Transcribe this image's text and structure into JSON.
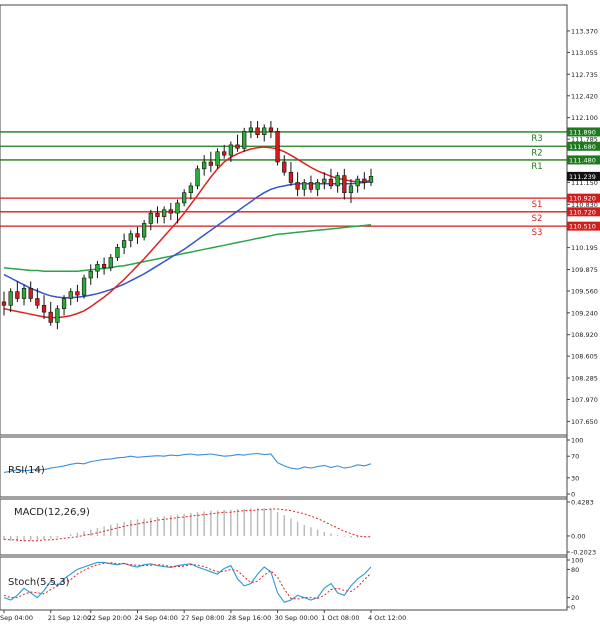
{
  "chart_data": {
    "type": "candlestick",
    "main": {
      "ylim": [
        107.45,
        113.75
      ],
      "yticks": [
        "113.370",
        "113.055",
        "112.735",
        "112.420",
        "112.100",
        "111.785",
        "111.465",
        "111.150",
        "110.830",
        "110.515",
        "110.195",
        "109.875",
        "109.560",
        "109.240",
        "108.920",
        "108.605",
        "108.285",
        "107.970",
        "107.650"
      ],
      "ytick_values": [
        113.37,
        113.055,
        112.735,
        112.42,
        112.1,
        111.785,
        111.465,
        111.15,
        110.83,
        110.515,
        110.195,
        109.875,
        109.56,
        109.24,
        108.92,
        108.605,
        108.285,
        107.97,
        107.65
      ],
      "current_price": {
        "label": "111.239",
        "value": 111.239
      },
      "levels": [
        {
          "name": "R3",
          "value": 111.89,
          "label": "111.890",
          "kind": "resistance"
        },
        {
          "name": "R2",
          "value": 111.68,
          "label": "111.680",
          "kind": "resistance"
        },
        {
          "name": "R1",
          "value": 111.48,
          "label": "111.480",
          "kind": "resistance"
        },
        {
          "name": "S1",
          "value": 110.92,
          "label": "110.920",
          "kind": "support"
        },
        {
          "name": "S2",
          "value": 110.72,
          "label": "110.720",
          "kind": "support"
        },
        {
          "name": "S3",
          "value": 110.51,
          "label": "110.510",
          "kind": "support"
        }
      ],
      "candles": [
        [
          109.4,
          109.55,
          109.2,
          109.35
        ],
        [
          109.35,
          109.6,
          109.25,
          109.55
        ],
        [
          109.55,
          109.7,
          109.4,
          109.45
        ],
        [
          109.45,
          109.65,
          109.35,
          109.6
        ],
        [
          109.6,
          109.7,
          109.4,
          109.45
        ],
        [
          109.45,
          109.6,
          109.3,
          109.35
        ],
        [
          109.35,
          109.5,
          109.15,
          109.25
        ],
        [
          109.25,
          109.4,
          109.05,
          109.1
        ],
        [
          109.1,
          109.35,
          109.0,
          109.3
        ],
        [
          109.3,
          109.5,
          109.2,
          109.45
        ],
        [
          109.45,
          109.6,
          109.35,
          109.55
        ],
        [
          109.55,
          109.65,
          109.4,
          109.5
        ],
        [
          109.5,
          109.8,
          109.45,
          109.75
        ],
        [
          109.75,
          109.95,
          109.65,
          109.85
        ],
        [
          109.85,
          110.0,
          109.75,
          109.95
        ],
        [
          109.95,
          110.05,
          109.8,
          109.9
        ],
        [
          109.9,
          110.1,
          109.85,
          110.05
        ],
        [
          110.05,
          110.25,
          110.0,
          110.2
        ],
        [
          110.2,
          110.4,
          110.1,
          110.3
        ],
        [
          110.3,
          110.45,
          110.2,
          110.4
        ],
        [
          110.4,
          110.5,
          110.25,
          110.35
        ],
        [
          110.35,
          110.6,
          110.3,
          110.55
        ],
        [
          110.55,
          110.75,
          110.45,
          110.7
        ],
        [
          110.7,
          110.8,
          110.55,
          110.65
        ],
        [
          110.65,
          110.8,
          110.55,
          110.75
        ],
        [
          110.75,
          110.85,
          110.6,
          110.7
        ],
        [
          110.7,
          110.9,
          110.55,
          110.85
        ],
        [
          110.85,
          111.05,
          110.8,
          111.0
        ],
        [
          111.0,
          111.15,
          110.9,
          111.1
        ],
        [
          111.1,
          111.4,
          111.05,
          111.35
        ],
        [
          111.35,
          111.55,
          111.25,
          111.45
        ],
        [
          111.45,
          111.6,
          111.3,
          111.4
        ],
        [
          111.4,
          111.65,
          111.35,
          111.6
        ],
        [
          111.6,
          111.7,
          111.5,
          111.55
        ],
        [
          111.55,
          111.75,
          111.45,
          111.7
        ],
        [
          111.7,
          111.85,
          111.6,
          111.65
        ],
        [
          111.65,
          111.95,
          111.6,
          111.9
        ],
        [
          111.9,
          112.05,
          111.8,
          111.95
        ],
        [
          111.95,
          112.05,
          111.8,
          111.85
        ],
        [
          111.85,
          112.0,
          111.75,
          111.95
        ],
        [
          111.95,
          112.05,
          111.8,
          111.9
        ],
        [
          111.9,
          111.95,
          111.4,
          111.45
        ],
        [
          111.45,
          111.55,
          111.25,
          111.3
        ],
        [
          111.3,
          111.45,
          111.1,
          111.15
        ],
        [
          111.15,
          111.3,
          110.95,
          111.05
        ],
        [
          111.05,
          111.2,
          110.95,
          111.15
        ],
        [
          111.15,
          111.25,
          111.0,
          111.05
        ],
        [
          111.05,
          111.2,
          110.95,
          111.15
        ],
        [
          111.15,
          111.3,
          111.05,
          111.2
        ],
        [
          111.2,
          111.35,
          111.05,
          111.1
        ],
        [
          111.1,
          111.3,
          111.0,
          111.25
        ],
        [
          111.25,
          111.35,
          110.9,
          111.0
        ],
        [
          111.0,
          111.2,
          110.85,
          111.1
        ],
        [
          111.1,
          111.25,
          111.0,
          111.2
        ],
        [
          111.2,
          111.3,
          111.05,
          111.15
        ],
        [
          111.15,
          111.35,
          111.1,
          111.24
        ]
      ],
      "ma_fast": [
        109.3,
        109.28,
        109.26,
        109.24,
        109.22,
        109.2,
        109.18,
        109.17,
        109.17,
        109.18,
        109.2,
        109.23,
        109.27,
        109.33,
        109.4,
        109.47,
        109.55,
        109.64,
        109.73,
        109.83,
        109.93,
        110.03,
        110.14,
        110.25,
        110.36,
        110.47,
        110.58,
        110.7,
        110.83,
        110.96,
        111.1,
        111.23,
        111.35,
        111.45,
        111.52,
        111.57,
        111.61,
        111.64,
        111.66,
        111.67,
        111.66,
        111.64,
        111.6,
        111.55,
        111.49,
        111.43,
        111.37,
        111.32,
        111.28,
        111.24,
        111.21,
        111.19,
        111.17,
        111.16,
        111.16,
        111.18
      ],
      "ma_mid": [
        109.8,
        109.75,
        109.7,
        109.65,
        109.6,
        109.56,
        109.52,
        109.49,
        109.47,
        109.46,
        109.46,
        109.47,
        109.48,
        109.5,
        109.52,
        109.55,
        109.58,
        109.62,
        109.66,
        109.71,
        109.76,
        109.81,
        109.87,
        109.93,
        109.99,
        110.05,
        110.11,
        110.17,
        110.24,
        110.31,
        110.38,
        110.45,
        110.52,
        110.59,
        110.66,
        110.73,
        110.8,
        110.87,
        110.94,
        111.0,
        111.05,
        111.08,
        111.1,
        111.12,
        111.13,
        111.13,
        111.13,
        111.13,
        111.13,
        111.13,
        111.13,
        111.13,
        111.13,
        111.14,
        111.15,
        111.16
      ],
      "ma_slow": [
        109.9,
        109.89,
        109.88,
        109.87,
        109.86,
        109.86,
        109.85,
        109.85,
        109.85,
        109.85,
        109.85,
        109.85,
        109.86,
        109.87,
        109.88,
        109.89,
        109.9,
        109.92,
        109.93,
        109.95,
        109.97,
        109.99,
        110.01,
        110.03,
        110.05,
        110.07,
        110.09,
        110.11,
        110.13,
        110.15,
        110.17,
        110.19,
        110.21,
        110.23,
        110.25,
        110.27,
        110.29,
        110.31,
        110.33,
        110.35,
        110.37,
        110.39,
        110.4,
        110.41,
        110.42,
        110.43,
        110.44,
        110.45,
        110.46,
        110.47,
        110.48,
        110.49,
        110.5,
        110.51,
        110.52,
        110.53
      ]
    },
    "x_labels": [
      "Sep 04:00",
      "21 Sep 12:00",
      "22 Sep 20:00",
      "24 Sep 04:00",
      "27 Sep 08:00",
      "28 Sep 16:00",
      "30 Sep 00:00",
      "1 Oct 08:00",
      "4 Oct 12:00"
    ],
    "x_label_index": [
      0,
      7,
      13,
      20,
      27,
      34,
      41,
      48,
      55
    ],
    "rsi": {
      "title": "RSI(14)",
      "ylim": [
        0,
        100
      ],
      "yticks": [
        "100",
        "70",
        "30",
        "0"
      ],
      "ytick_values": [
        100,
        70,
        30,
        0
      ],
      "values": [
        40,
        42,
        45,
        43,
        44,
        46,
        45,
        48,
        50,
        52,
        55,
        57,
        56,
        60,
        62,
        64,
        65,
        67,
        68,
        70,
        68,
        69,
        70,
        71,
        70,
        72,
        71,
        73,
        74,
        72,
        73,
        74,
        72,
        70,
        71,
        73,
        72,
        74,
        75,
        73,
        74,
        58,
        52,
        48,
        46,
        50,
        48,
        51,
        53,
        49,
        52,
        48,
        50,
        54,
        52,
        56
      ]
    },
    "macd": {
      "title": "MACD(12,26,9)",
      "ylim": [
        -0.2023,
        0.4283
      ],
      "yticks": [
        "0.4283",
        "0.00",
        "-0.2023"
      ],
      "ytick_values": [
        0.4283,
        0.0,
        -0.2023
      ],
      "histogram": [
        -0.05,
        -0.06,
        -0.07,
        -0.07,
        -0.06,
        -0.05,
        -0.04,
        -0.03,
        -0.02,
        0.0,
        0.02,
        0.04,
        0.06,
        0.08,
        0.1,
        0.12,
        0.14,
        0.16,
        0.18,
        0.2,
        0.21,
        0.22,
        0.23,
        0.24,
        0.25,
        0.26,
        0.27,
        0.28,
        0.29,
        0.3,
        0.31,
        0.32,
        0.32,
        0.33,
        0.33,
        0.34,
        0.34,
        0.35,
        0.35,
        0.35,
        0.34,
        0.3,
        0.26,
        0.22,
        0.18,
        0.14,
        0.11,
        0.08,
        0.05,
        0.03,
        0.01,
        -0.01,
        -0.02,
        -0.02,
        -0.01,
        0.0
      ],
      "signal": [
        -0.04,
        -0.05,
        -0.05,
        -0.06,
        -0.06,
        -0.06,
        -0.05,
        -0.05,
        -0.04,
        -0.03,
        -0.02,
        -0.01,
        0.01,
        0.02,
        0.04,
        0.06,
        0.08,
        0.1,
        0.12,
        0.14,
        0.15,
        0.17,
        0.18,
        0.2,
        0.21,
        0.22,
        0.23,
        0.24,
        0.25,
        0.26,
        0.27,
        0.28,
        0.29,
        0.3,
        0.3,
        0.31,
        0.32,
        0.32,
        0.33,
        0.33,
        0.34,
        0.34,
        0.33,
        0.32,
        0.3,
        0.28,
        0.25,
        0.22,
        0.18,
        0.14,
        0.1,
        0.06,
        0.03,
        0.0,
        -0.01,
        -0.01
      ]
    },
    "stoch": {
      "title": "Stoch(5,5,3)",
      "ylim": [
        0,
        100
      ],
      "yticks": [
        "100",
        "80",
        "20",
        "0"
      ],
      "ytick_values": [
        100,
        80,
        20,
        0
      ],
      "k": [
        20,
        15,
        25,
        40,
        30,
        20,
        35,
        55,
        45,
        60,
        70,
        80,
        85,
        90,
        95,
        95,
        92,
        90,
        93,
        88,
        85,
        90,
        92,
        88,
        86,
        84,
        88,
        90,
        92,
        85,
        80,
        75,
        70,
        82,
        88,
        60,
        45,
        50,
        70,
        85,
        75,
        30,
        10,
        15,
        25,
        20,
        15,
        20,
        40,
        50,
        30,
        25,
        45,
        60,
        70,
        85
      ],
      "d": [
        25,
        20,
        20,
        27,
        32,
        30,
        28,
        37,
        45,
        53,
        58,
        70,
        78,
        85,
        90,
        93,
        94,
        92,
        92,
        90,
        89,
        88,
        89,
        90,
        89,
        86,
        86,
        87,
        90,
        89,
        86,
        80,
        75,
        76,
        80,
        77,
        64,
        52,
        55,
        68,
        77,
        63,
        38,
        18,
        17,
        20,
        20,
        18,
        25,
        37,
        40,
        35,
        33,
        43,
        58,
        72
      ]
    }
  }
}
